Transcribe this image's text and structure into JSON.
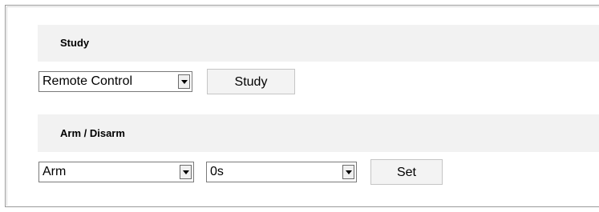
{
  "study": {
    "header": "Study",
    "remote_select_value": "Remote Control",
    "study_button": "Study"
  },
  "arm_disarm": {
    "header": "Arm / Disarm",
    "mode_select_value": "Arm",
    "delay_select_value": "0s",
    "set_button": "Set"
  },
  "icons": {
    "dropdown": "chevron-down-icon"
  },
  "colors": {
    "section_header_bg": "#f2f2f2",
    "button_bg": "#f3f3f3"
  }
}
